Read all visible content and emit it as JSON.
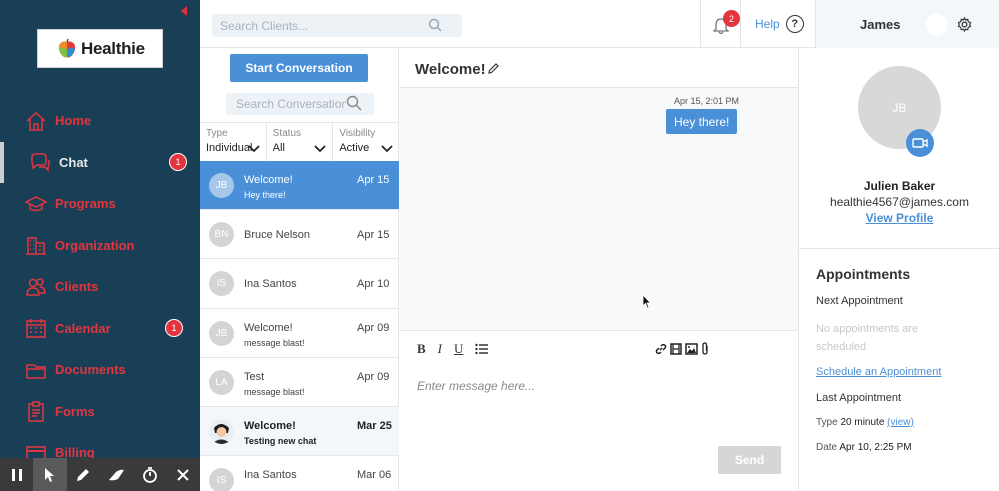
{
  "brand": {
    "name": "Healthie"
  },
  "sidebar": {
    "items": [
      {
        "label": "Home",
        "icon": "home-icon"
      },
      {
        "label": "Chat",
        "icon": "chat-icon",
        "badge": "1",
        "active": true
      },
      {
        "label": "Programs",
        "icon": "graduation-cap-icon"
      },
      {
        "label": "Organization",
        "icon": "building-icon"
      },
      {
        "label": "Clients",
        "icon": "users-icon"
      },
      {
        "label": "Calendar",
        "icon": "calendar-icon",
        "badge": "1"
      },
      {
        "label": "Documents",
        "icon": "folder-icon"
      },
      {
        "label": "Forms",
        "icon": "clipboard-icon"
      },
      {
        "label": "Billing",
        "icon": "billing-icon"
      }
    ],
    "accent": "#e4353f",
    "background": "#183f55"
  },
  "recorder_toolbar": {
    "buttons": [
      "pause-icon",
      "pointer-icon",
      "pencil-icon",
      "eraser-icon",
      "timer-icon",
      "close-icon"
    ]
  },
  "topbar": {
    "search_placeholder": "Search Clients...",
    "notification_count": "2",
    "help_label": "Help",
    "help_glyph": "?",
    "user_name": "James"
  },
  "conversations": {
    "start_label": "Start Conversation",
    "search_placeholder": "Search Conversations",
    "filters": [
      {
        "label": "Type",
        "value": "Individual"
      },
      {
        "label": "Status",
        "value": "All"
      },
      {
        "label": "Visibility",
        "value": "Active"
      }
    ],
    "items": [
      {
        "initials": "JB",
        "name": "Welcome!",
        "preview": "Hey there!",
        "date": "Apr 15",
        "state": "selected"
      },
      {
        "initials": "BN",
        "name": "Bruce Nelson",
        "preview": "",
        "date": "Apr 15",
        "state": ""
      },
      {
        "initials": "IS",
        "name": "Ina Santos",
        "preview": "",
        "date": "Apr 10",
        "state": ""
      },
      {
        "initials": "JB",
        "name": "Welcome!",
        "preview": "message blast!",
        "date": "Apr 09",
        "state": ""
      },
      {
        "initials": "LA",
        "name": "Test",
        "preview": "message blast!",
        "date": "Apr 09",
        "state": ""
      },
      {
        "initials": "",
        "name": "Welcome!",
        "preview": "Testing new chat",
        "date": "Mar 25",
        "state": "unread"
      },
      {
        "initials": "IS",
        "name": "Ina Santos",
        "preview": "",
        "date": "Mar 06",
        "state": ""
      }
    ]
  },
  "chat": {
    "title": "Welcome!",
    "messages": [
      {
        "time": "Apr 15, 2:01 PM",
        "text": "Hey there!"
      }
    ],
    "format_tools": [
      "B",
      "I",
      "U"
    ],
    "input_placeholder": "Enter message here...",
    "send_label": "Send"
  },
  "profile": {
    "initials": "JB",
    "name": "Julien Baker",
    "email": "healthie4567@james.com",
    "view_profile_label": "View Profile"
  },
  "appointments": {
    "title": "Appointments",
    "next_label": "Next Appointment",
    "empty_text": "No appointments are scheduled",
    "schedule_link": "Schedule an Appointment",
    "last_label": "Last Appointment",
    "type_label": "Type",
    "type_value": "20 minute",
    "type_link": "(view)",
    "date_label": "Date",
    "date_value": "Apr 10, 2:25 PM"
  }
}
